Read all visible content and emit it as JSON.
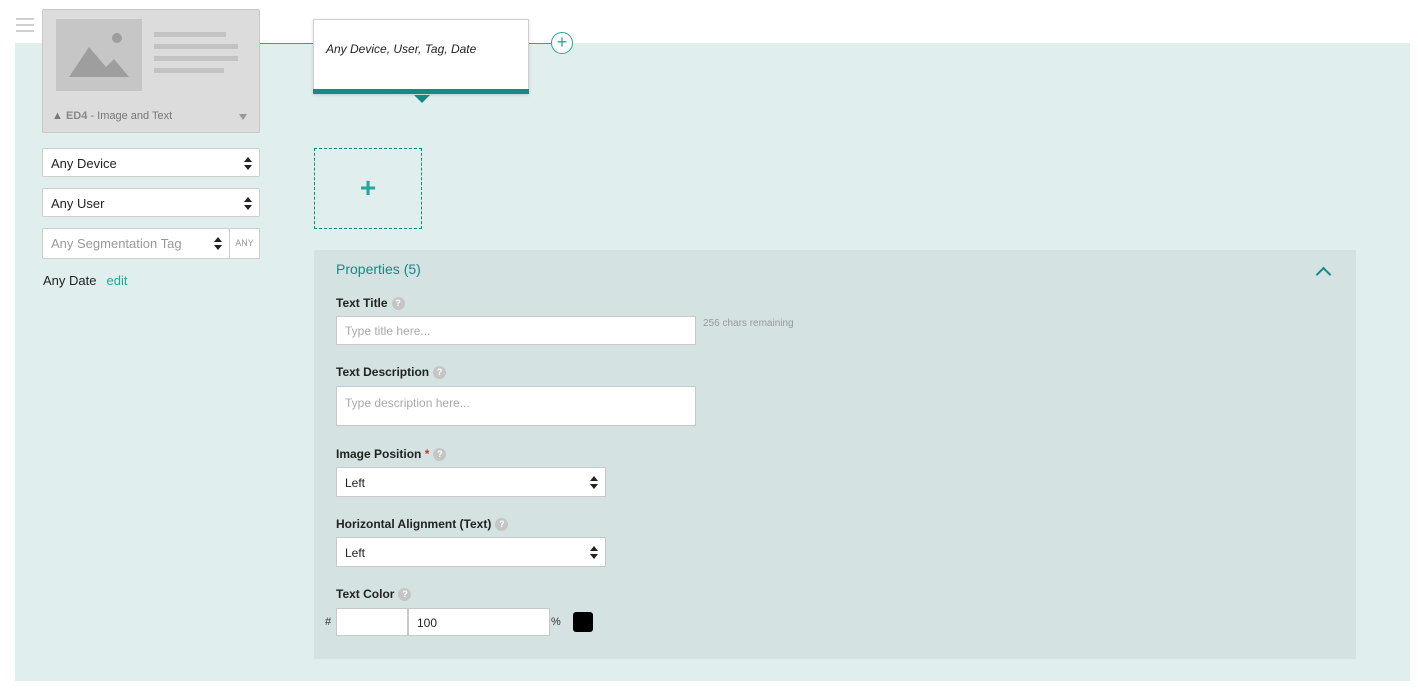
{
  "colors": {
    "accent": "#26a69a",
    "accent_dark": "#138b84",
    "canvas_bg": "#e0eeee",
    "panel_bg": "#d4e2e2",
    "swatch": "#000000"
  },
  "widget": {
    "code": "ED4",
    "name": " - Image and Text",
    "icon": "warning-icon"
  },
  "targeting": {
    "device": "Any Device",
    "user": "Any User",
    "tag_placeholder": "Any Segmentation Tag",
    "any_label": "ANY",
    "date": "Any Date",
    "edit_label": "edit"
  },
  "segment": {
    "summary": "Any Device, User, Tag, Date"
  },
  "add_box": {
    "icon": "+"
  },
  "properties": {
    "title": "Properties (5)",
    "help_glyph": "?",
    "required_mark": "*",
    "text_title": {
      "label": "Text Title",
      "placeholder": "Type title here...",
      "remaining": "256 chars remaining"
    },
    "text_description": {
      "label": "Text Description",
      "placeholder": "Type description here..."
    },
    "image_position": {
      "label": "Image Position",
      "value": "Left"
    },
    "horizontal_alignment": {
      "label": "Horizontal Alignment (Text)",
      "value": "Left"
    },
    "text_color": {
      "label": "Text Color",
      "hash": "#",
      "hex": "",
      "opacity": "100",
      "percent": "%"
    }
  }
}
